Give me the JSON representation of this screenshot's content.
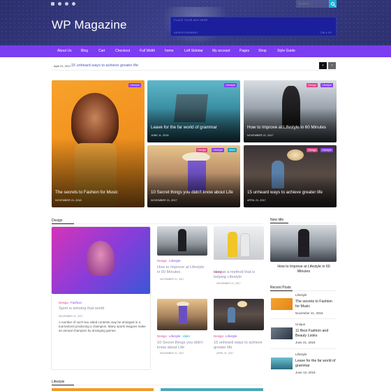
{
  "header": {
    "site_title": "WP Magazine",
    "search_placeholder": "Search...",
    "ad_top_label": "PLACE YOUR ADS HERE",
    "ad_left_label": "ADVERTISEMENT",
    "ad_right_label": "728 x 90"
  },
  "nav": {
    "items": [
      "About Us",
      "Blog",
      "Cart",
      "Checkout",
      "Full Width",
      "home",
      "Left Sidebar",
      "My account",
      "Pages",
      "Shop",
      "Style Guide"
    ]
  },
  "ticker": {
    "date": "April 21, 2017",
    "text": "15 unheard ways to achieve greater life"
  },
  "featured": [
    {
      "title": "The secrets to Fashion for Music",
      "date": "NOVEMBER 21, 2018",
      "tags": [
        "Lifestyle"
      ]
    },
    {
      "title": "Leave for the far world of grammar",
      "date": "JUNE 11, 2018",
      "tags": [
        "Lifestyle"
      ]
    },
    {
      "title": "How to Improve at Lifestyle in 60 Minutes",
      "date": "NOVEMBER 21, 2017",
      "tags": [
        "Design",
        "Lifestyle"
      ]
    },
    {
      "title": "10 Secret things you didn't know about Life",
      "date": "NOVEMBER 21, 2017",
      "tags": [
        "Design",
        "Lifestyle",
        "slider"
      ]
    },
    {
      "title": "15 unheard ways to achieve greater life",
      "date": "APRIL 21, 2017",
      "tags": [
        "Design",
        "Lifestyle"
      ]
    }
  ],
  "design_section": {
    "heading": "Design",
    "main": {
      "cats": [
        "Design",
        "Fashion"
      ],
      "title": "Sport is winning that world",
      "date": "NOVEMBER 21, 2017",
      "excerpt": "A number of such two sided contests may be arranged in a tournament producing a champion. Many sports leagues make an annual champion by arranging games."
    },
    "posts": [
      {
        "cats": [
          "Design",
          "Lifestyle"
        ],
        "title": "How to Improve at Lifestyle in 60 Minutes",
        "date": "NOVEMBER 21, 2017"
      },
      {
        "cats": [
          "Design"
        ],
        "title": "Here is a method that is helping Lifestyle",
        "date": "NOVEMBER 21, 2017"
      },
      {
        "cats": [
          "Design",
          "Lifestyle",
          "slider"
        ],
        "title": "10 Secret things you didn't know about Life",
        "date": "NOVEMBER 21, 2017"
      },
      {
        "cats": [
          "Design",
          "Lifestyle"
        ],
        "title": "15 unheard ways to achieve greater life",
        "date": "APRIL 21, 2017"
      }
    ]
  },
  "sidebar": {
    "new_title_heading": "New title",
    "new_title_post": "How to Improve at Lifestyle in 60 Minutes",
    "recent_heading": "Recent Posts",
    "recent": [
      {
        "cat": "Lifestyle",
        "title": "The secrets to Fashion for Music",
        "date": "November 21, 2018"
      },
      {
        "cat": "Unique",
        "title": "11 Best Fashion and Beauty Looks",
        "date": "June 21, 2018"
      },
      {
        "cat": "Lifestyle",
        "title": "Leave for the far world of grammar",
        "date": "June 13, 2018"
      }
    ]
  },
  "lifestyle_section": {
    "heading": "Lifestyle"
  },
  "colors": {
    "nav": "#7c3cf0",
    "accent": "#8a3df3",
    "pink": "#e0428a",
    "teal": "#16a5c7",
    "header": "#2b2f6e"
  }
}
